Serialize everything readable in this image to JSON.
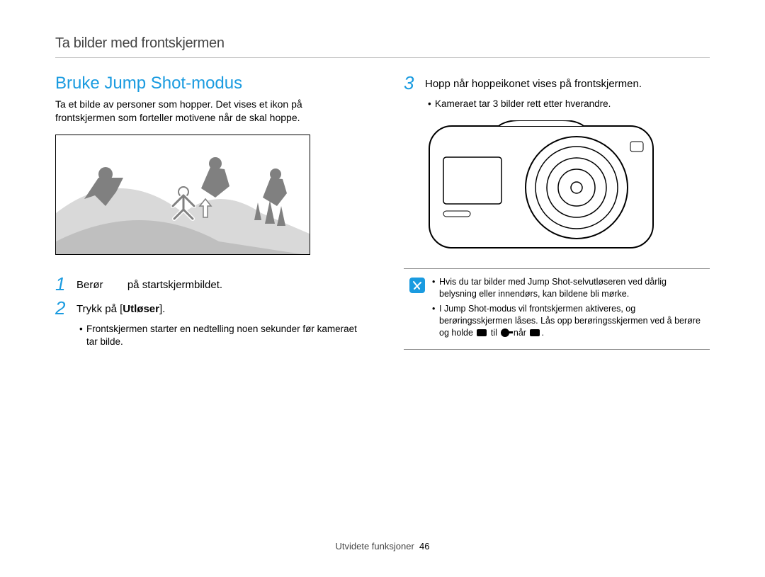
{
  "header": {
    "breadcrumb": "Ta bilder med frontskjermen"
  },
  "left": {
    "title": "Bruke Jump Shot-modus",
    "intro": "Ta et bilde av personer som hopper. Det vises et ikon på frontskjermen som forteller motivene når de skal hoppe.",
    "steps": {
      "s1": {
        "num": "1",
        "before": "Berør",
        "after": " på startskjermbildet."
      },
      "s2": {
        "num": "2",
        "before": "Trykk på [",
        "bold": "Utløser",
        "after": "]."
      }
    },
    "sub": "Frontskjermen starter en nedtelling noen sekunder før kameraet tar bilde."
  },
  "right": {
    "steps": {
      "s3": {
        "num": "3",
        "text": "Hopp når hoppeikonet vises på frontskjermen."
      }
    },
    "sub": "Kameraet tar 3 bilder rett etter hverandre.",
    "notes": {
      "n1": "Hvis du tar bilder med Jump Shot-selvutløseren ved dårlig belysning eller innendørs, kan bildene bli mørke.",
      "n2_a": "I Jump Shot-modus vil frontskjermen aktiveres, og berøringsskjermen låses. Lås opp berøringsskjermen ved å berøre og holde ",
      "n2_b": " til ",
      "n2_c": " når ",
      "n2_d": "."
    }
  },
  "footer": {
    "section": "Utvidete funksjoner",
    "page": "46"
  }
}
